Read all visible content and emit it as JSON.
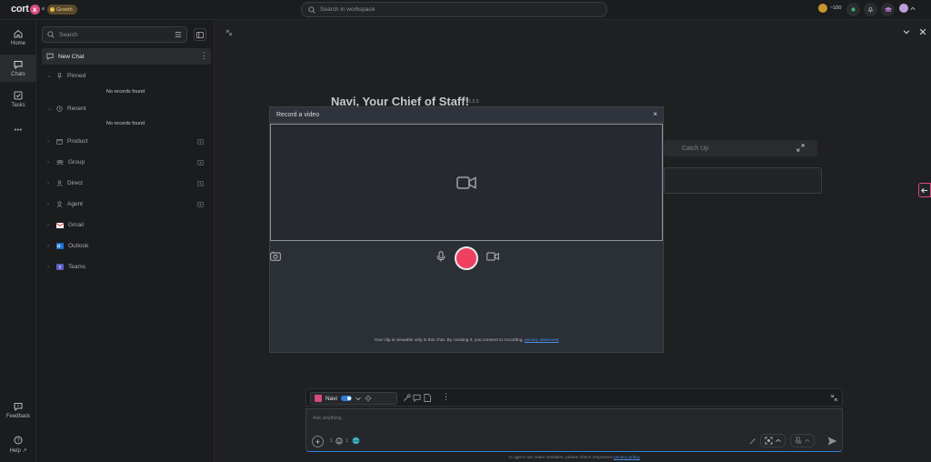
{
  "topbar": {
    "logo": "cort",
    "logo_x": "x",
    "logo_suffix": "ai",
    "badge": "Growth",
    "search_placeholder": "Search in workspace",
    "coins": "~100"
  },
  "rail": {
    "home": "Home",
    "chats": "Chats",
    "tasks": "Tasks",
    "more": "•••",
    "feedback": "Feedback",
    "help": "Help"
  },
  "sidebar": {
    "search_placeholder": "Search",
    "new_chat": "New Chat",
    "sections": [
      "Pinned",
      "Recent",
      "Product",
      "Group",
      "Direct",
      "Agent",
      "Gmail",
      "Outlook",
      "Teams"
    ],
    "no_records": "No records found"
  },
  "main": {
    "title": "Navi, Your Chief of Staff!",
    "version": "v1.5.5",
    "catchup": "Catch Up"
  },
  "modal": {
    "title": "Record a video",
    "close": "×",
    "note_prefix": "Your clip is viewable only in this chat. By creating it, you consent to recording",
    "note_link": "privacy statement"
  },
  "composer": {
    "agent": "Navi",
    "placeholder": "Ask anything...",
    "count_a": "1",
    "count_b": "1"
  },
  "footer": {
    "disclaimer": "AI agent can make mistakes, please check responses",
    "link": "privacy policy"
  },
  "colors": {
    "accent": "#d64a7e",
    "record": "#f04060",
    "link": "#4d8de8"
  }
}
